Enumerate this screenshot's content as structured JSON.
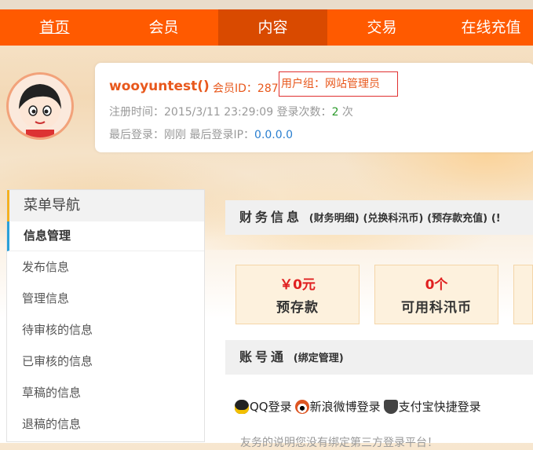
{
  "nav": {
    "items": [
      "首页",
      "会员",
      "内容",
      "交易",
      "在线充值"
    ],
    "active_index": 2
  },
  "profile": {
    "username": "wooyuntest()",
    "member_id_label": "会员ID：287",
    "user_group": "用户组：网站管理员",
    "register_label": "注册时间：2015/3/11 23:29:09 登录次数：",
    "login_count": "2",
    "login_count_unit": " 次",
    "last_login_label": "最后登录：刚刚 最后登录IP：",
    "last_ip": "0.0.0.0"
  },
  "sidebar": {
    "title": "菜单导航",
    "active": "信息管理",
    "items": [
      "发布信息",
      "管理信息",
      "待审核的信息",
      "已审核的信息",
      "草稿的信息",
      "退稿的信息"
    ]
  },
  "finance": {
    "title": "财务信息",
    "links": [
      "(财务明细)",
      "(兑换科汛币)",
      "(预存款充值)",
      "(!"
    ]
  },
  "stats": [
    {
      "value": "￥0元",
      "label": "预存款"
    },
    {
      "value": "0个",
      "label": "可用科汛币"
    }
  ],
  "account": {
    "title": "账号通",
    "link": "(绑定管理)",
    "logins": [
      "QQ登录",
      "新浪微博登录",
      "支付宝快捷登录"
    ],
    "note": "友务的说明您没有绑定第三方登录平台！"
  },
  "colors": {
    "nav_bg": "#ff5a00",
    "nav_active": "#d94a00",
    "accent": "#e8581c"
  }
}
